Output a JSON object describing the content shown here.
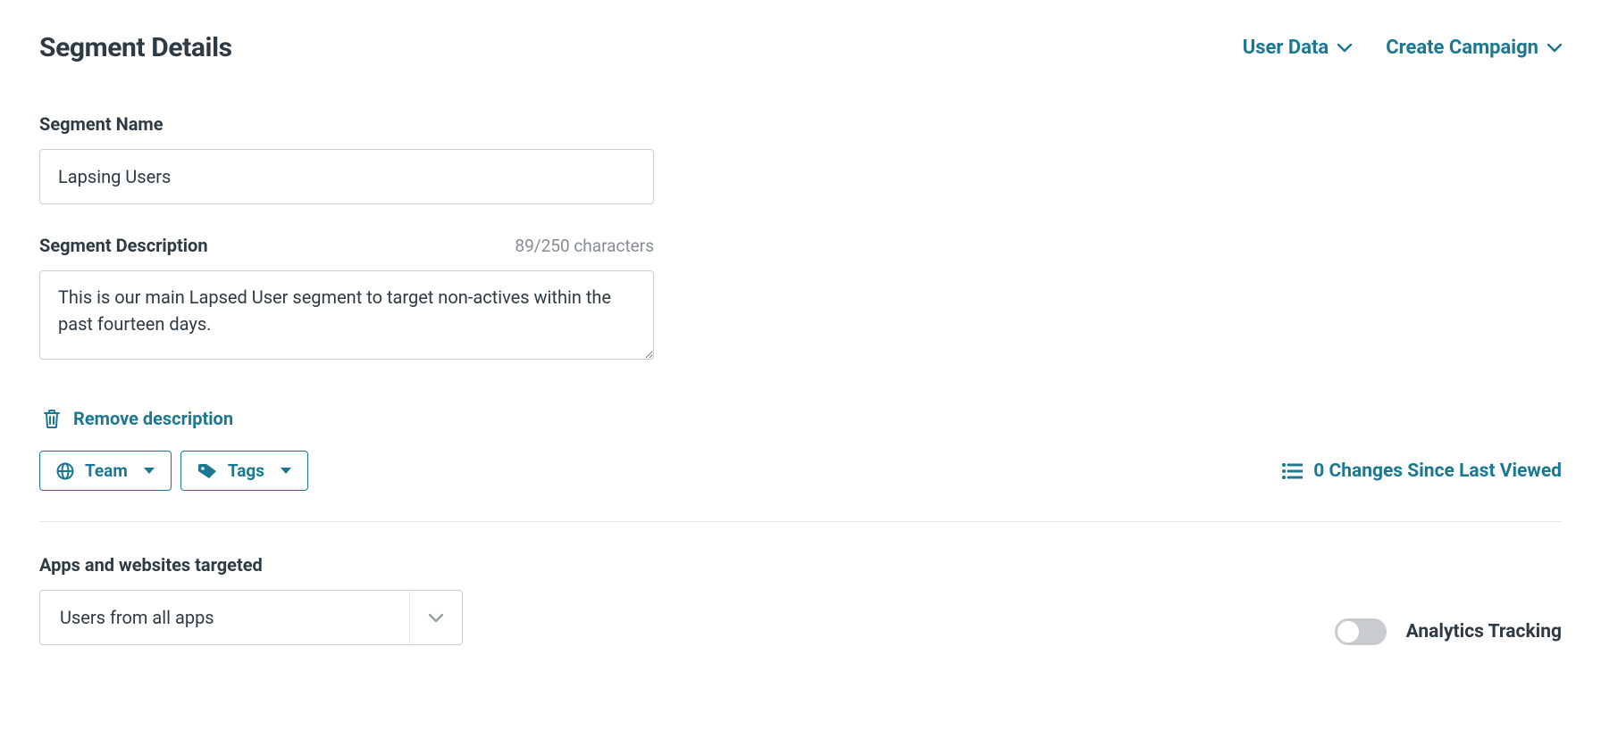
{
  "header": {
    "title": "Segment Details",
    "actions": {
      "user_data": "User Data",
      "create_campaign": "Create Campaign"
    }
  },
  "segment_name": {
    "label": "Segment Name",
    "value": "Lapsing Users"
  },
  "segment_description": {
    "label": "Segment Description",
    "counter": "89/250 characters",
    "value": "This is our main Lapsed User segment to target non-actives within the past fourteen days."
  },
  "remove_description_label": "Remove description",
  "team_button_label": "Team",
  "tags_button_label": "Tags",
  "changes_label": "0 Changes Since Last Viewed",
  "apps_section": {
    "label": "Apps and websites targeted",
    "selected": "Users from all apps"
  },
  "analytics_tracking": {
    "label": "Analytics Tracking"
  },
  "colors": {
    "accent": "#1a7892"
  }
}
